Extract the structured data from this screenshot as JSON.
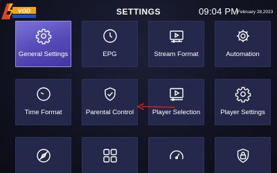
{
  "header": {
    "logo_text": "4K VOD",
    "title": "SETTINGS",
    "time": "09:04 PM",
    "date": "February 28,2023"
  },
  "tiles": [
    {
      "label": "General Settings",
      "icon": "gear-icon",
      "selected": true
    },
    {
      "label": "EPG",
      "icon": "clock-icon",
      "selected": false
    },
    {
      "label": "Stream Format",
      "icon": "stream-format-icon",
      "selected": false
    },
    {
      "label": "Automation",
      "icon": "automation-gear-icon",
      "selected": false
    },
    {
      "label": "Time Format",
      "icon": "clock-icon",
      "selected": false
    },
    {
      "label": "Parental Control",
      "icon": "shield-check-icon",
      "selected": false
    },
    {
      "label": "Player Selection",
      "icon": "player-icon",
      "selected": false
    },
    {
      "label": "Player Settings",
      "icon": "settings-gear-icon",
      "selected": false
    },
    {
      "label": "",
      "icon": "compass-icon",
      "selected": false
    },
    {
      "label": "",
      "icon": "grid-icon",
      "selected": false
    },
    {
      "label": "",
      "icon": "speedometer-icon",
      "selected": false
    },
    {
      "label": "",
      "icon": "vpn-lock-icon",
      "selected": false
    }
  ],
  "colors": {
    "background": "#121423",
    "tile": "#24284a",
    "selected_tile": "#6a5fcf",
    "annotation_arrow": "#d81e1e",
    "icon_stroke": "#ffffff"
  }
}
